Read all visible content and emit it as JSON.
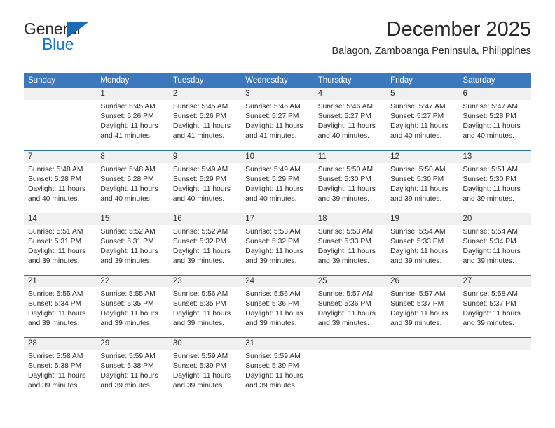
{
  "logo": {
    "word1": "General",
    "word2": "Blue",
    "triangle_color": "#1b6cb5",
    "blue_text_color": "#1b79c8"
  },
  "header": {
    "title": "December 2025",
    "subtitle": "Balagon, Zamboanga Peninsula, Philippines"
  },
  "theme": {
    "header_blue": "#3b78bc",
    "divider_blue": "#2e6da8",
    "band_gray": "#f0f0f0",
    "text": "#2b2b2b"
  },
  "weekdays": [
    "Sunday",
    "Monday",
    "Tuesday",
    "Wednesday",
    "Thursday",
    "Friday",
    "Saturday"
  ],
  "weeks": [
    [
      {
        "day": "",
        "sunrise": "",
        "sunset": "",
        "daylight_line1": "",
        "daylight_line2": ""
      },
      {
        "day": "1",
        "sunrise": "Sunrise: 5:45 AM",
        "sunset": "Sunset: 5:26 PM",
        "daylight_line1": "Daylight: 11 hours",
        "daylight_line2": "and 41 minutes."
      },
      {
        "day": "2",
        "sunrise": "Sunrise: 5:45 AM",
        "sunset": "Sunset: 5:26 PM",
        "daylight_line1": "Daylight: 11 hours",
        "daylight_line2": "and 41 minutes."
      },
      {
        "day": "3",
        "sunrise": "Sunrise: 5:46 AM",
        "sunset": "Sunset: 5:27 PM",
        "daylight_line1": "Daylight: 11 hours",
        "daylight_line2": "and 41 minutes."
      },
      {
        "day": "4",
        "sunrise": "Sunrise: 5:46 AM",
        "sunset": "Sunset: 5:27 PM",
        "daylight_line1": "Daylight: 11 hours",
        "daylight_line2": "and 40 minutes."
      },
      {
        "day": "5",
        "sunrise": "Sunrise: 5:47 AM",
        "sunset": "Sunset: 5:27 PM",
        "daylight_line1": "Daylight: 11 hours",
        "daylight_line2": "and 40 minutes."
      },
      {
        "day": "6",
        "sunrise": "Sunrise: 5:47 AM",
        "sunset": "Sunset: 5:28 PM",
        "daylight_line1": "Daylight: 11 hours",
        "daylight_line2": "and 40 minutes."
      }
    ],
    [
      {
        "day": "7",
        "sunrise": "Sunrise: 5:48 AM",
        "sunset": "Sunset: 5:28 PM",
        "daylight_line1": "Daylight: 11 hours",
        "daylight_line2": "and 40 minutes."
      },
      {
        "day": "8",
        "sunrise": "Sunrise: 5:48 AM",
        "sunset": "Sunset: 5:28 PM",
        "daylight_line1": "Daylight: 11 hours",
        "daylight_line2": "and 40 minutes."
      },
      {
        "day": "9",
        "sunrise": "Sunrise: 5:49 AM",
        "sunset": "Sunset: 5:29 PM",
        "daylight_line1": "Daylight: 11 hours",
        "daylight_line2": "and 40 minutes."
      },
      {
        "day": "10",
        "sunrise": "Sunrise: 5:49 AM",
        "sunset": "Sunset: 5:29 PM",
        "daylight_line1": "Daylight: 11 hours",
        "daylight_line2": "and 40 minutes."
      },
      {
        "day": "11",
        "sunrise": "Sunrise: 5:50 AM",
        "sunset": "Sunset: 5:30 PM",
        "daylight_line1": "Daylight: 11 hours",
        "daylight_line2": "and 39 minutes."
      },
      {
        "day": "12",
        "sunrise": "Sunrise: 5:50 AM",
        "sunset": "Sunset: 5:30 PM",
        "daylight_line1": "Daylight: 11 hours",
        "daylight_line2": "and 39 minutes."
      },
      {
        "day": "13",
        "sunrise": "Sunrise: 5:51 AM",
        "sunset": "Sunset: 5:30 PM",
        "daylight_line1": "Daylight: 11 hours",
        "daylight_line2": "and 39 minutes."
      }
    ],
    [
      {
        "day": "14",
        "sunrise": "Sunrise: 5:51 AM",
        "sunset": "Sunset: 5:31 PM",
        "daylight_line1": "Daylight: 11 hours",
        "daylight_line2": "and 39 minutes."
      },
      {
        "day": "15",
        "sunrise": "Sunrise: 5:52 AM",
        "sunset": "Sunset: 5:31 PM",
        "daylight_line1": "Daylight: 11 hours",
        "daylight_line2": "and 39 minutes."
      },
      {
        "day": "16",
        "sunrise": "Sunrise: 5:52 AM",
        "sunset": "Sunset: 5:32 PM",
        "daylight_line1": "Daylight: 11 hours",
        "daylight_line2": "and 39 minutes."
      },
      {
        "day": "17",
        "sunrise": "Sunrise: 5:53 AM",
        "sunset": "Sunset: 5:32 PM",
        "daylight_line1": "Daylight: 11 hours",
        "daylight_line2": "and 39 minutes."
      },
      {
        "day": "18",
        "sunrise": "Sunrise: 5:53 AM",
        "sunset": "Sunset: 5:33 PM",
        "daylight_line1": "Daylight: 11 hours",
        "daylight_line2": "and 39 minutes."
      },
      {
        "day": "19",
        "sunrise": "Sunrise: 5:54 AM",
        "sunset": "Sunset: 5:33 PM",
        "daylight_line1": "Daylight: 11 hours",
        "daylight_line2": "and 39 minutes."
      },
      {
        "day": "20",
        "sunrise": "Sunrise: 5:54 AM",
        "sunset": "Sunset: 5:34 PM",
        "daylight_line1": "Daylight: 11 hours",
        "daylight_line2": "and 39 minutes."
      }
    ],
    [
      {
        "day": "21",
        "sunrise": "Sunrise: 5:55 AM",
        "sunset": "Sunset: 5:34 PM",
        "daylight_line1": "Daylight: 11 hours",
        "daylight_line2": "and 39 minutes."
      },
      {
        "day": "22",
        "sunrise": "Sunrise: 5:55 AM",
        "sunset": "Sunset: 5:35 PM",
        "daylight_line1": "Daylight: 11 hours",
        "daylight_line2": "and 39 minutes."
      },
      {
        "day": "23",
        "sunrise": "Sunrise: 5:56 AM",
        "sunset": "Sunset: 5:35 PM",
        "daylight_line1": "Daylight: 11 hours",
        "daylight_line2": "and 39 minutes."
      },
      {
        "day": "24",
        "sunrise": "Sunrise: 5:56 AM",
        "sunset": "Sunset: 5:36 PM",
        "daylight_line1": "Daylight: 11 hours",
        "daylight_line2": "and 39 minutes."
      },
      {
        "day": "25",
        "sunrise": "Sunrise: 5:57 AM",
        "sunset": "Sunset: 5:36 PM",
        "daylight_line1": "Daylight: 11 hours",
        "daylight_line2": "and 39 minutes."
      },
      {
        "day": "26",
        "sunrise": "Sunrise: 5:57 AM",
        "sunset": "Sunset: 5:37 PM",
        "daylight_line1": "Daylight: 11 hours",
        "daylight_line2": "and 39 minutes."
      },
      {
        "day": "27",
        "sunrise": "Sunrise: 5:58 AM",
        "sunset": "Sunset: 5:37 PM",
        "daylight_line1": "Daylight: 11 hours",
        "daylight_line2": "and 39 minutes."
      }
    ],
    [
      {
        "day": "28",
        "sunrise": "Sunrise: 5:58 AM",
        "sunset": "Sunset: 5:38 PM",
        "daylight_line1": "Daylight: 11 hours",
        "daylight_line2": "and 39 minutes."
      },
      {
        "day": "29",
        "sunrise": "Sunrise: 5:59 AM",
        "sunset": "Sunset: 5:38 PM",
        "daylight_line1": "Daylight: 11 hours",
        "daylight_line2": "and 39 minutes."
      },
      {
        "day": "30",
        "sunrise": "Sunrise: 5:59 AM",
        "sunset": "Sunset: 5:39 PM",
        "daylight_line1": "Daylight: 11 hours",
        "daylight_line2": "and 39 minutes."
      },
      {
        "day": "31",
        "sunrise": "Sunrise: 5:59 AM",
        "sunset": "Sunset: 5:39 PM",
        "daylight_line1": "Daylight: 11 hours",
        "daylight_line2": "and 39 minutes."
      },
      {
        "day": "",
        "sunrise": "",
        "sunset": "",
        "daylight_line1": "",
        "daylight_line2": ""
      },
      {
        "day": "",
        "sunrise": "",
        "sunset": "",
        "daylight_line1": "",
        "daylight_line2": ""
      },
      {
        "day": "",
        "sunrise": "",
        "sunset": "",
        "daylight_line1": "",
        "daylight_line2": ""
      }
    ]
  ]
}
